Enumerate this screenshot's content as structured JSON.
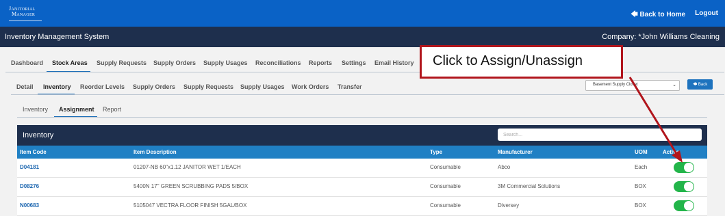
{
  "header": {
    "logo_line1": "Janitorial",
    "logo_line2": "Manager",
    "back_to_home": "Back to Home",
    "logout": "Logout"
  },
  "subheader": {
    "title": "Inventory Management System",
    "company": "Company: *John Williams Cleaning"
  },
  "main_tabs": [
    "Dashboard",
    "Stock Areas",
    "Supply Requests",
    "Supply Orders",
    "Supply Usages",
    "Reconciliations",
    "Reports",
    "Settings",
    "Email History"
  ],
  "main_tabs_active": "Stock Areas",
  "sub_tabs": [
    "Detail",
    "Inventory",
    "Reorder Levels",
    "Supply Orders",
    "Supply Requests",
    "Supply Usages",
    "Work Orders",
    "Transfer"
  ],
  "sub_tabs_active": "Inventory",
  "inner_tabs": [
    "Inventory",
    "Assignment",
    "Report"
  ],
  "inner_tabs_active": "Assignment",
  "location_select": {
    "value": "Basement Supply Closet"
  },
  "back_button": "Back",
  "panel": {
    "title": "Inventory",
    "search_placeholder": "Search..."
  },
  "table": {
    "columns": [
      "Item Code",
      "Item Description",
      "Type",
      "Manufacturer",
      "UOM",
      "Active"
    ],
    "rows": [
      {
        "code": "D04181",
        "description": "01207-NB 60\"x1.12 JANITOR WET 1/EACH",
        "type": "Consumable",
        "manufacturer": "Abco",
        "uom": "Each",
        "active": true
      },
      {
        "code": "D08276",
        "description": "5400N 17\" GREEN SCRUBBING PADS 5/BOX",
        "type": "Consumable",
        "manufacturer": "3M Commercial Solutions",
        "uom": "BOX",
        "active": true
      },
      {
        "code": "N00683",
        "description": "5105047 VECTRA FLOOR FINISH 5GAL/BOX",
        "type": "Consumable",
        "manufacturer": "Diversey",
        "uom": "BOX",
        "active": true
      }
    ]
  },
  "callout": {
    "text": "Click to Assign/Unassign"
  },
  "colors": {
    "topbar": "#0a62c6",
    "navy": "#1e2f4d",
    "table_header": "#2080c4",
    "toggle_on": "#23b54a",
    "callout_border": "#b1151c"
  }
}
